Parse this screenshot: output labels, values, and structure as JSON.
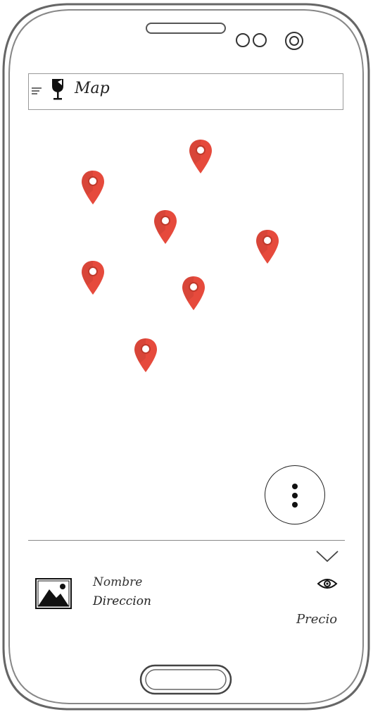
{
  "toolbar": {
    "title": "Map",
    "menu_icon": "hamburger-menu-icon",
    "logo_icon": "wine-glass-icon"
  },
  "map": {
    "pin_color": "#e64a3c",
    "pin_count": 7
  },
  "fab": {
    "icon": "more-vert-icon"
  },
  "detail": {
    "name": "Nombre",
    "address": "Direccion",
    "price": "Precio",
    "expand_icon": "chevron-down-icon",
    "view_icon": "eye-icon",
    "thumbnail_icon": "image-placeholder-icon"
  }
}
